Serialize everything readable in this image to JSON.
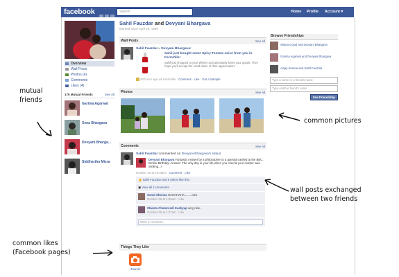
{
  "header": {
    "logo": "facebook",
    "search_placeholder": "Search",
    "nav": [
      "Home",
      "Profile",
      "Account ▾"
    ]
  },
  "profile": {
    "person1": "Sahil Fauzdar",
    "conj": "and",
    "person2": "Devyani Bhargava",
    "married": "Married since April 26, 1999"
  },
  "left_nav": [
    "Overview",
    "Wall Posts",
    "Photos (4)",
    "Comments",
    "Likes (4)"
  ],
  "mutual_friends": {
    "header": "176 Mutual Friends",
    "see_all": "See All",
    "list": [
      "Garima Agarwal",
      "Xena Bhargava",
      "Devyani Bharga...",
      "Siddhartha Misra"
    ]
  },
  "wall_posts": {
    "header": "Wall Posts",
    "see_all": "See All",
    "post": {
      "author": "Sahil Fauzdar",
      "arrow": "▸",
      "target": "Devyani Bhargava:",
      "headline": "Sahil just bought some Spicy Tomato Juice from you in FarmVille!",
      "body": "Sahil just shopped at your Winery and absolutely loves your goods. They hope you'll accept the small token of their appreciation!",
      "meta": "20 hours ago via FarmVille ·",
      "actions": [
        "Comment",
        "Like",
        "Get a Sample"
      ]
    }
  },
  "photos": {
    "header": "Photos",
    "see_all": "See All"
  },
  "comments": {
    "header": "Comments",
    "see_all": "See All",
    "story": {
      "author": "Sahil Fauzdar",
      "text": "commented on",
      "target": "Devyani Bhargava's status.",
      "quote_author": "Devyani Bhargava",
      "quote": "Fantastic Answer by a philosopher to a question asked at the BBC. Define Birthday: Answer: The only day in your life,when you cried & your mother was Smiling...!",
      "meta": "October 25 at 10:09pm ·",
      "actions": [
        "Comment",
        "Like"
      ],
      "likes": "Sahil Fauzdar and 9 others like this.",
      "view_all": "View all 4 comments",
      "replies": [
        {
          "name": "Sonal Sharma",
          "text": "HAHAHAHA.........nice",
          "time": "October 26 at 1:05am · Like"
        },
        {
          "name": "Shweta Chaturvedi Kashyap",
          "text": "very nice..",
          "time": "October 26 at 1:27am · Like"
        }
      ],
      "input_placeholder": "Write a comment..."
    }
  },
  "likes": {
    "header": "Things They Like",
    "item": "Zoomin",
    "item_color": "#f26522"
  },
  "browse": {
    "header": "Browse Friendships",
    "items": [
      "Shipra Goyal and Devyani Bhargava",
      "Garima Agarwal and Devyani Bhargava",
      "Anjay Surana and Sahil Fauzdar"
    ],
    "input1": "Type a name or a friend's name",
    "input2": "Type another friend's name",
    "button": "See Friendship"
  },
  "annotations": {
    "mutual": [
      "mutual",
      "friends"
    ],
    "pictures": "common pictures",
    "wall": [
      "wall posts exchanged",
      "between two friends"
    ],
    "likes": [
      "common likes",
      "(Facebook pages)"
    ]
  },
  "colors": {
    "brand": "#3b5998",
    "link": "#3b5998",
    "bar": "#f2f2f2"
  }
}
